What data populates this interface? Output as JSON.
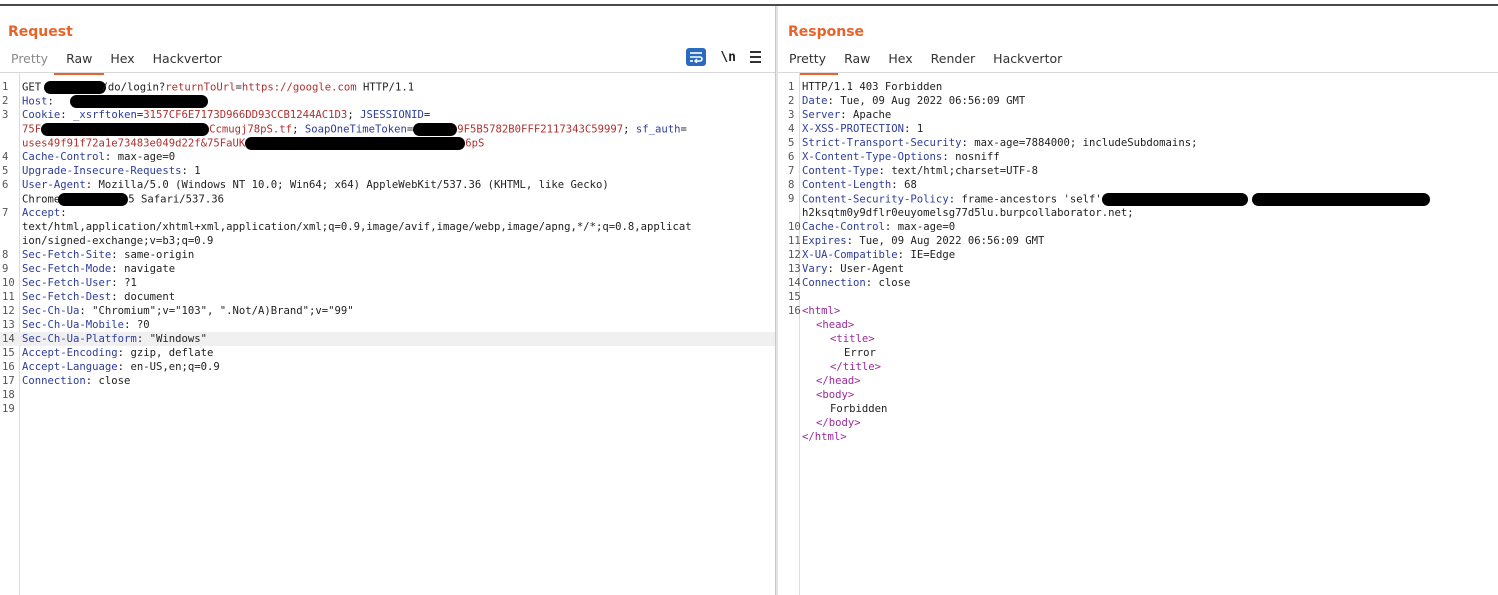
{
  "request": {
    "title": "Request",
    "tabs": [
      {
        "label": "Pretty",
        "state": "inactive"
      },
      {
        "label": "Raw",
        "state": "active"
      },
      {
        "label": "Hex",
        "state": "normal"
      },
      {
        "label": "Hackvertor",
        "state": "normal"
      }
    ],
    "toolbar": {
      "newline_label": "\\n"
    },
    "lines": {
      "l1": {
        "method": "GET ",
        "path_a": "/do/login?",
        "param_k": "returnToUrl",
        "eq": "=",
        "param_v": "https://google.com",
        "ver": " HTTP/1.1"
      },
      "l2": {
        "k": "Host",
        "sep": ": "
      },
      "l3": {
        "k": "Cookie",
        "sep": ": ",
        "c1k": "_xsrftoken",
        "c1v": "3157CF6E7173D966DD93CCB1244AC1D3",
        "c2k": "JSESSIONID"
      },
      "l3b": {
        "a": "75F",
        "b": "Ccmugj78pS.tf",
        "c": "; ",
        "c3k": "SoapOneTimeToken",
        "c3v": "9F5B5782B0FFF2117343C59997",
        "d": "; ",
        "c4k": "sf_auth",
        "e": "="
      },
      "l3c": {
        "a": "uses49f91f72a1e73483e049d22f&75FaUK",
        "b": "6pS"
      },
      "l4": {
        "k": "Cache-Control",
        "v": "max-age=0"
      },
      "l5": {
        "k": "Upgrade-Insecure-Requests",
        "v": "1"
      },
      "l6": {
        "k": "User-Agent",
        "v": "Mozilla/5.0 (Windows NT 10.0; Win64; x64) AppleWebKit/537.36 (KHTML, like Gecko)"
      },
      "l6b": {
        "a": "Chrome",
        "b": "5 Safari/537.36"
      },
      "l7": {
        "k": "Accept",
        "sep": ":"
      },
      "l7b": "text/html,application/xhtml+xml,application/xml;q=0.9,image/avif,image/webp,image/apng,*/*;q=0.8,applicat",
      "l7c": "ion/signed-exchange;v=b3;q=0.9",
      "l8": {
        "k": "Sec-Fetch-Site",
        "v": "same-origin"
      },
      "l9": {
        "k": "Sec-Fetch-Mode",
        "v": "navigate"
      },
      "l10": {
        "k": "Sec-Fetch-User",
        "v": "?1"
      },
      "l11": {
        "k": "Sec-Fetch-Dest",
        "v": "document"
      },
      "l12": {
        "k": "Sec-Ch-Ua",
        "v": "\"Chromium\";v=\"103\", \".Not/A)Brand\";v=\"99\""
      },
      "l13": {
        "k": "Sec-Ch-Ua-Mobile",
        "v": "?0"
      },
      "l14": {
        "k": "Sec-Ch-Ua-Platform",
        "v": "\"Windows\""
      },
      "l15": {
        "k": "Accept-Encoding",
        "v": "gzip, deflate"
      },
      "l16": {
        "k": "Accept-Language",
        "v": "en-US,en;q=0.9"
      },
      "l17": {
        "k": "Connection",
        "v": "close"
      }
    },
    "line_numbers": [
      "1",
      "2",
      "3",
      "4",
      "5",
      "6",
      "7",
      "8",
      "9",
      "10",
      "11",
      "12",
      "13",
      "14",
      "15",
      "16",
      "17",
      "18",
      "19"
    ]
  },
  "response": {
    "title": "Response",
    "tabs": [
      {
        "label": "Pretty",
        "state": "active"
      },
      {
        "label": "Raw",
        "state": "normal"
      },
      {
        "label": "Hex",
        "state": "normal"
      },
      {
        "label": "Render",
        "state": "normal"
      },
      {
        "label": "Hackvertor",
        "state": "normal"
      }
    ],
    "lines": {
      "l1": "HTTP/1.1 403 Forbidden",
      "l2": {
        "k": "Date",
        "v": "Tue, 09 Aug 2022 06:56:09 GMT"
      },
      "l3": {
        "k": "Server",
        "v": "Apache"
      },
      "l4": {
        "k": "X-XSS-PROTECTION",
        "v": "1"
      },
      "l5": {
        "k": "Strict-Transport-Security",
        "v": "max-age=7884000; includeSubdomains;"
      },
      "l6": {
        "k": "X-Content-Type-Options",
        "v": "nosniff"
      },
      "l7": {
        "k": "Content-Type",
        "v": "text/html;charset=UTF-8"
      },
      "l8": {
        "k": "Content-Length",
        "v": "68"
      },
      "l9": {
        "k": "Content-Security-Policy",
        "v": "frame-ancestors 'self'"
      },
      "l9b": "h2ksqtm0y9dflr0euyomelsg77d5lu.burpcollaborator.net;",
      "l10": {
        "k": "Cache-Control",
        "v": "max-age=0"
      },
      "l11": {
        "k": "Expires",
        "v": "Tue, 09 Aug 2022 06:56:09 GMT"
      },
      "l12": {
        "k": "X-UA-Compatible",
        "v": "IE=Edge"
      },
      "l13": {
        "k": "Vary",
        "v": "User-Agent"
      },
      "l14": {
        "k": "Connection",
        "v": "close"
      },
      "html_open": "<html>",
      "head_open": "<head>",
      "title_open": "<title>",
      "title_text": "Error",
      "title_close": "</title>",
      "head_close": "</head>",
      "body_open": "<body>",
      "body_text": "Forbidden",
      "body_close": "</body>",
      "html_close": "</html>"
    },
    "line_numbers": [
      "1",
      "2",
      "3",
      "4",
      "5",
      "6",
      "7",
      "8",
      "9",
      "10",
      "11",
      "12",
      "13",
      "14",
      "15",
      "16"
    ]
  }
}
